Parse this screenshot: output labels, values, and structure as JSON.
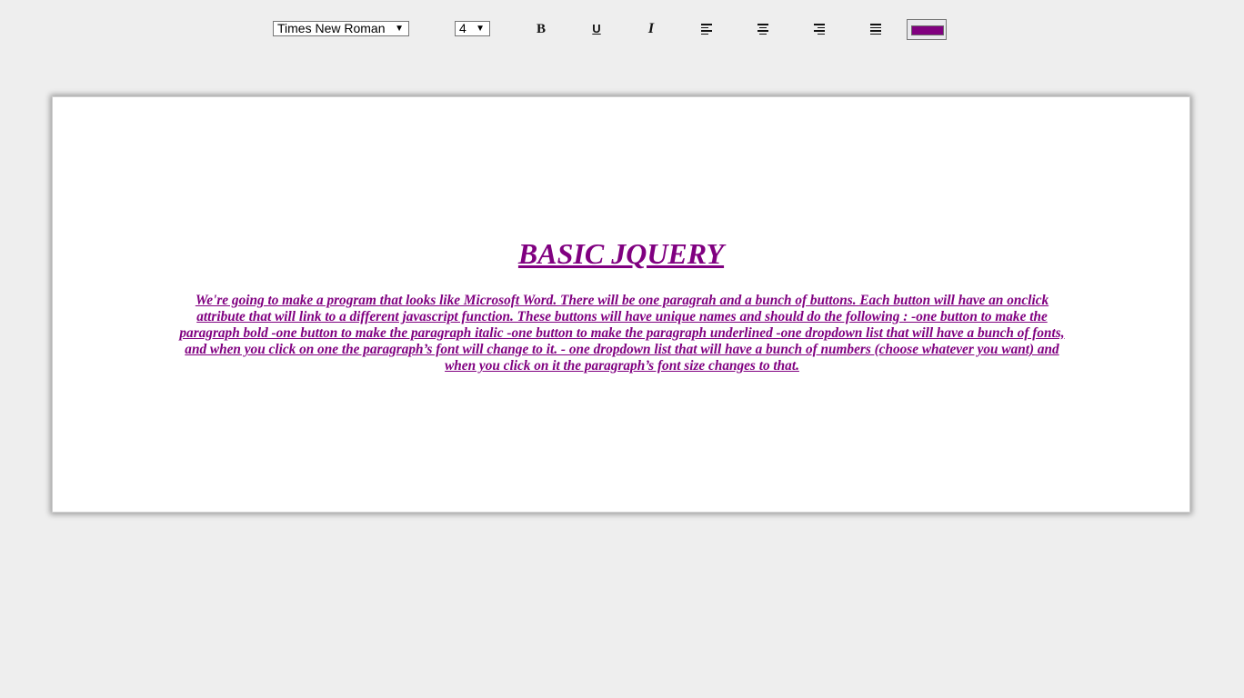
{
  "toolbar": {
    "font_select": {
      "value": "Times New Roman"
    },
    "size_select": {
      "value": "4"
    },
    "bold_label": "B",
    "underline_label": "U",
    "italic_label": "I",
    "icons": {
      "align_left": "align-left-icon",
      "align_center": "align-center-icon",
      "align_right": "align-right-icon",
      "align_justify": "align-justify-icon",
      "dropdown_arrow": "caret-down-icon"
    },
    "color_value": "#800080"
  },
  "document": {
    "title": "BASIC JQUERY",
    "paragraph": "We're going to make a program that looks like Microsoft Word. There will be one paragrah and a bunch of buttons. Each button will have an onclick attribute that will link to a different javascript function. These buttons will have unique names and should do the following : -one button to make the paragraph bold -one button to make the paragraph italic -one button to make the paragraph underlined -one dropdown list that will have a bunch of fonts, and when you click on one the paragraph’s font will change to it. - one dropdown list that will have a bunch of numbers (choose whatever you want) and when you click on it the paragraph’s font size changes to that.",
    "text_color": "#800080"
  }
}
